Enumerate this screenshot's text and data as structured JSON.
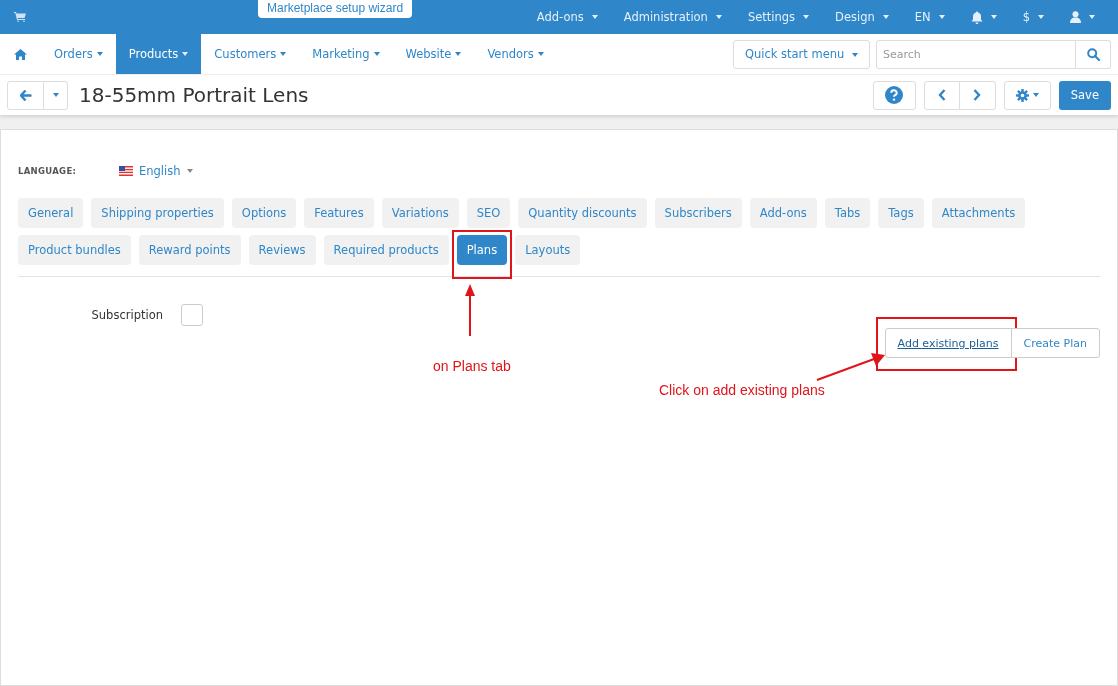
{
  "top_bar": {
    "wizard_label": "Marketplace setup wizard",
    "menus": [
      {
        "kind": "text",
        "label": "Add-ons"
      },
      {
        "kind": "text",
        "label": "Administration"
      },
      {
        "kind": "text",
        "label": "Settings"
      },
      {
        "kind": "text",
        "label": "Design"
      },
      {
        "kind": "text",
        "label": "EN"
      },
      {
        "kind": "bell"
      },
      {
        "kind": "text",
        "label": "$"
      },
      {
        "kind": "user"
      }
    ]
  },
  "main_nav": {
    "items": [
      {
        "label": "Orders",
        "selected": false
      },
      {
        "label": "Products",
        "selected": true
      },
      {
        "label": "Customers",
        "selected": false
      },
      {
        "label": "Marketing",
        "selected": false
      },
      {
        "label": "Website",
        "selected": false
      },
      {
        "label": "Vendors",
        "selected": false
      }
    ],
    "quick_start": "Quick start menu",
    "search": {
      "placeholder": "Search"
    }
  },
  "toolbar": {
    "title": "18-55mm Portrait Lens",
    "save": "Save"
  },
  "language": {
    "label": "LANGUAGE:",
    "value": "English"
  },
  "tab_rows": [
    [
      {
        "label": "General",
        "selected": false,
        "highlighted": false
      },
      {
        "label": "Shipping properties",
        "selected": false,
        "highlighted": false
      },
      {
        "label": "Options",
        "selected": false,
        "highlighted": false
      },
      {
        "label": "Features",
        "selected": false,
        "highlighted": false
      },
      {
        "label": "Variations",
        "selected": false,
        "highlighted": false
      },
      {
        "label": "SEO",
        "selected": false,
        "highlighted": false
      },
      {
        "label": "Quantity discounts",
        "selected": false,
        "highlighted": false
      },
      {
        "label": "Subscribers",
        "selected": false,
        "highlighted": false
      },
      {
        "label": "Add-ons",
        "selected": false,
        "highlighted": false
      },
      {
        "label": "Tabs",
        "selected": false,
        "highlighted": false
      },
      {
        "label": "Tags",
        "selected": false,
        "highlighted": false
      },
      {
        "label": "Attachments",
        "selected": false,
        "highlighted": false
      }
    ],
    [
      {
        "label": "Product bundles",
        "selected": false,
        "highlighted": false
      },
      {
        "label": "Reward points",
        "selected": false,
        "highlighted": false
      },
      {
        "label": "Reviews",
        "selected": false,
        "highlighted": false
      },
      {
        "label": "Required products",
        "selected": false,
        "highlighted": false
      },
      {
        "label": "Plans",
        "selected": true,
        "highlighted": true
      },
      {
        "label": "Layouts",
        "selected": false,
        "highlighted": false
      }
    ]
  ],
  "subscription": {
    "label": "Subscription",
    "checked": false
  },
  "plan_buttons": [
    {
      "label": "Add existing plans",
      "highlighted": true
    },
    {
      "label": "Create Plan",
      "highlighted": false
    }
  ],
  "annotations": [
    "on Plans tab",
    "Click on add existing plans"
  ]
}
